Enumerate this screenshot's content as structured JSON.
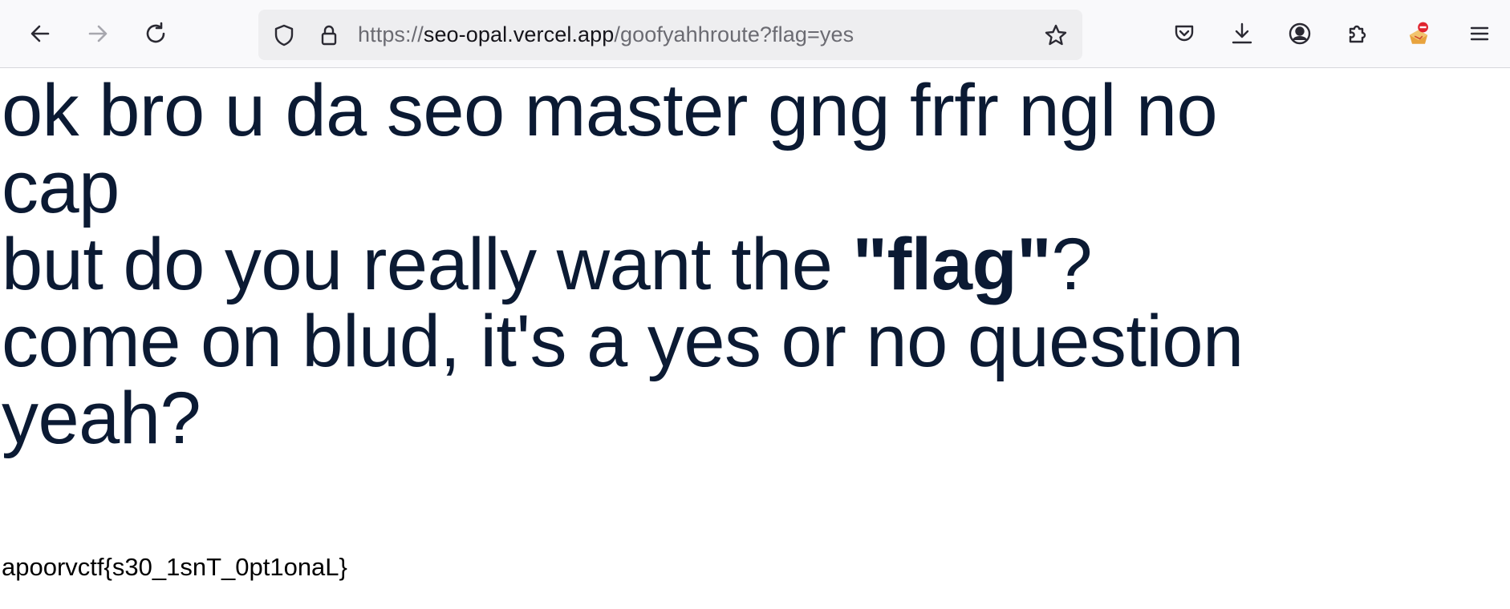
{
  "browser": {
    "url": {
      "scheme": "https://",
      "host": "seo-opal.vercel.app",
      "path": "/goofyahhroute?flag=yes"
    },
    "icons": {
      "back": "arrow-left-icon",
      "forward": "arrow-right-icon",
      "reload": "reload-icon",
      "tracking_protection": "shield-icon",
      "connection": "lock-icon",
      "bookmark": "star-icon",
      "pocket": "pocket-icon",
      "downloads": "download-icon",
      "account": "account-icon",
      "extensions": "puzzle-icon",
      "extension_badge": "extension-badge-icon",
      "menu": "hamburger-menu-icon"
    }
  },
  "page": {
    "line1": "ok bro u da seo master gng frfr ngl no",
    "line2": "cap",
    "line3_before": "but do you really want the ",
    "line3_bold": "\"flag\"",
    "line3_after": "?",
    "line4": "come on blud, it's a yes or no question",
    "line5": "yeah?",
    "flag_text": "apoorvctf{s30_1snT_0pt1onaL}"
  },
  "colors": {
    "toolbar_bg": "#f9f9fb",
    "urlbar_bg": "#eeeef0",
    "headline_text": "#0b1a33",
    "flag_text": "#000000"
  }
}
